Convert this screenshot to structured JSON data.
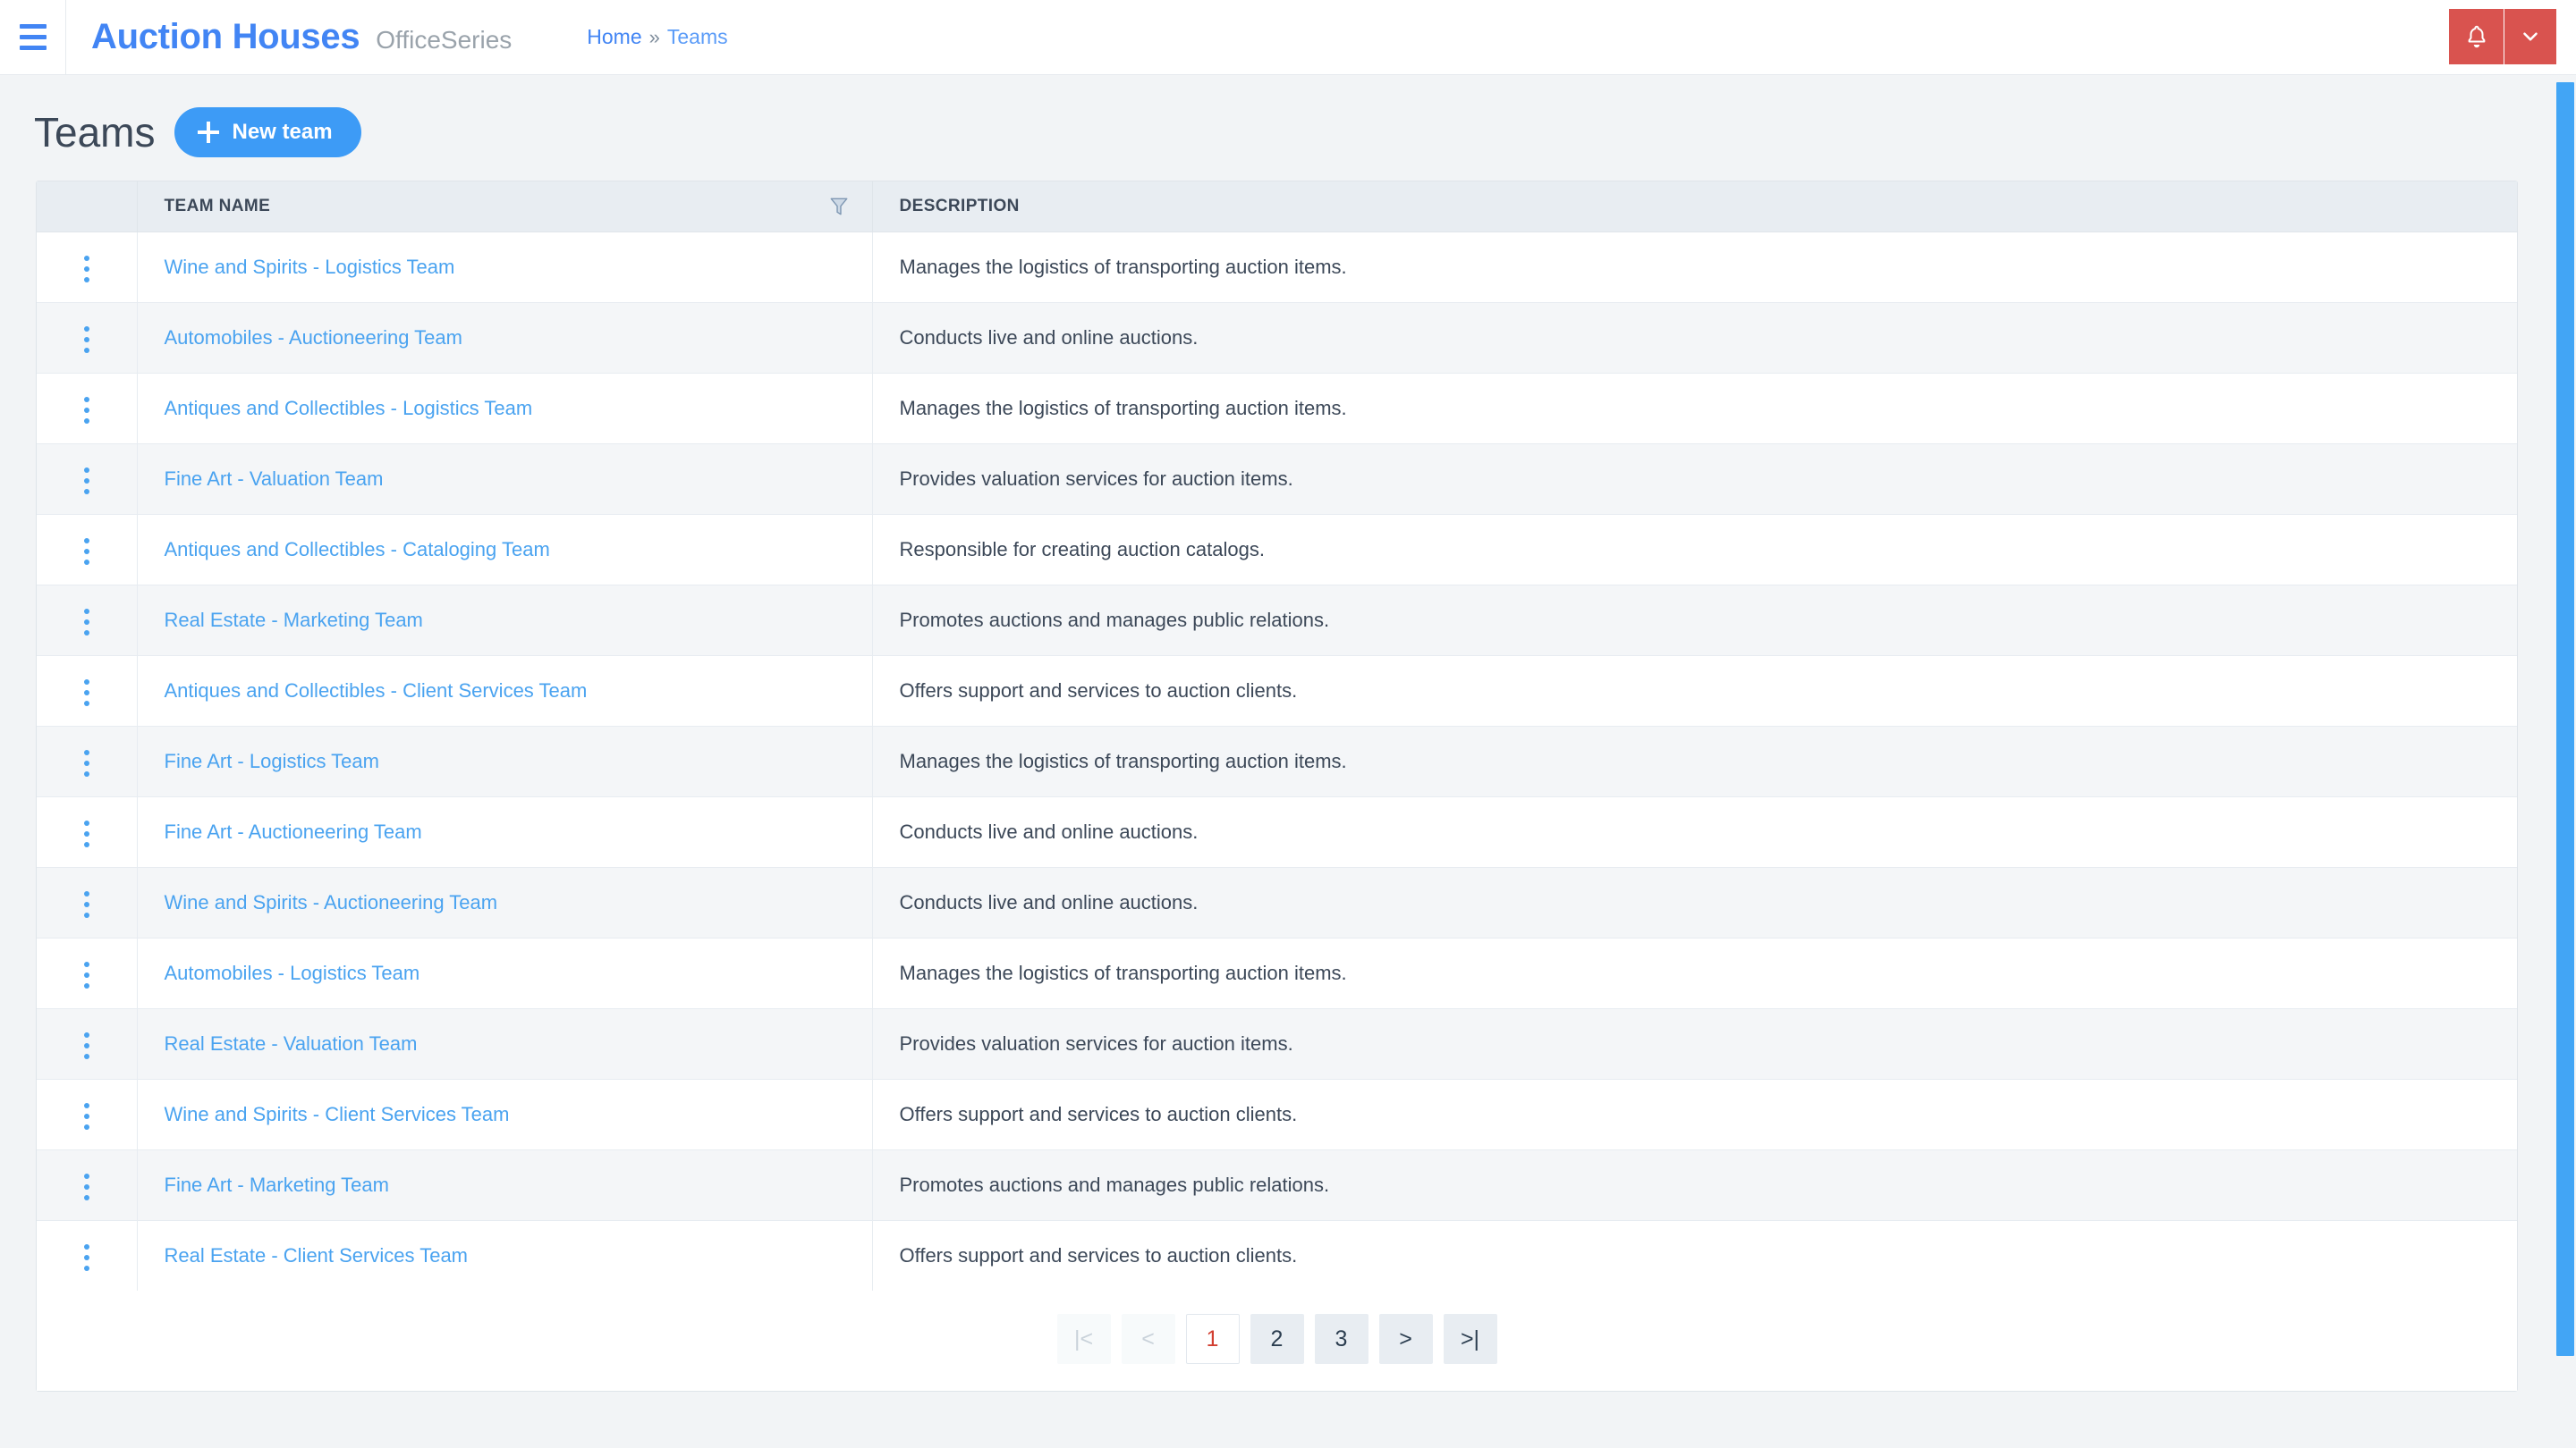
{
  "topbar": {
    "menu_icon": "hamburger-icon",
    "brand": "Auction Houses",
    "brand_suffix": "OfficeSeries",
    "breadcrumb": {
      "home": "Home",
      "separator": "»",
      "current": "Teams"
    },
    "notification_icon": "bell-icon",
    "caret_icon": "chevron-down-icon",
    "accent_red": "#d9534f",
    "accent_blue": "#4285f4"
  },
  "page": {
    "title": "Teams",
    "new_button_label": "New team",
    "new_button_icon": "plus-icon"
  },
  "table": {
    "columns": [
      "",
      "TEAM NAME",
      "DESCRIPTION"
    ],
    "filter_icon": "filter-funnel-icon",
    "row_menu_icon": "kebab-menu-icon",
    "rows": [
      {
        "name": "Wine and Spirits - Logistics Team",
        "description": "Manages the logistics of transporting auction items."
      },
      {
        "name": "Automobiles - Auctioneering Team",
        "description": "Conducts live and online auctions."
      },
      {
        "name": "Antiques and Collectibles - Logistics Team",
        "description": "Manages the logistics of transporting auction items."
      },
      {
        "name": "Fine Art - Valuation Team",
        "description": "Provides valuation services for auction items."
      },
      {
        "name": "Antiques and Collectibles - Cataloging Team",
        "description": "Responsible for creating auction catalogs."
      },
      {
        "name": "Real Estate - Marketing Team",
        "description": "Promotes auctions and manages public relations."
      },
      {
        "name": "Antiques and Collectibles - Client Services Team",
        "description": "Offers support and services to auction clients."
      },
      {
        "name": "Fine Art - Logistics Team",
        "description": "Manages the logistics of transporting auction items."
      },
      {
        "name": "Fine Art - Auctioneering Team",
        "description": "Conducts live and online auctions."
      },
      {
        "name": "Wine and Spirits - Auctioneering Team",
        "description": "Conducts live and online auctions."
      },
      {
        "name": "Automobiles - Logistics Team",
        "description": "Manages the logistics of transporting auction items."
      },
      {
        "name": "Real Estate - Valuation Team",
        "description": "Provides valuation services for auction items."
      },
      {
        "name": "Wine and Spirits - Client Services Team",
        "description": "Offers support and services to auction clients."
      },
      {
        "name": "Fine Art - Marketing Team",
        "description": "Promotes auctions and manages public relations."
      },
      {
        "name": "Real Estate - Client Services Team",
        "description": "Offers support and services to auction clients."
      }
    ]
  },
  "pagination": {
    "first_label": "|<",
    "prev_label": "<",
    "pages": [
      "1",
      "2",
      "3"
    ],
    "active_page": "1",
    "next_label": ">",
    "last_label": ">|",
    "active_color": "#d23f31"
  }
}
